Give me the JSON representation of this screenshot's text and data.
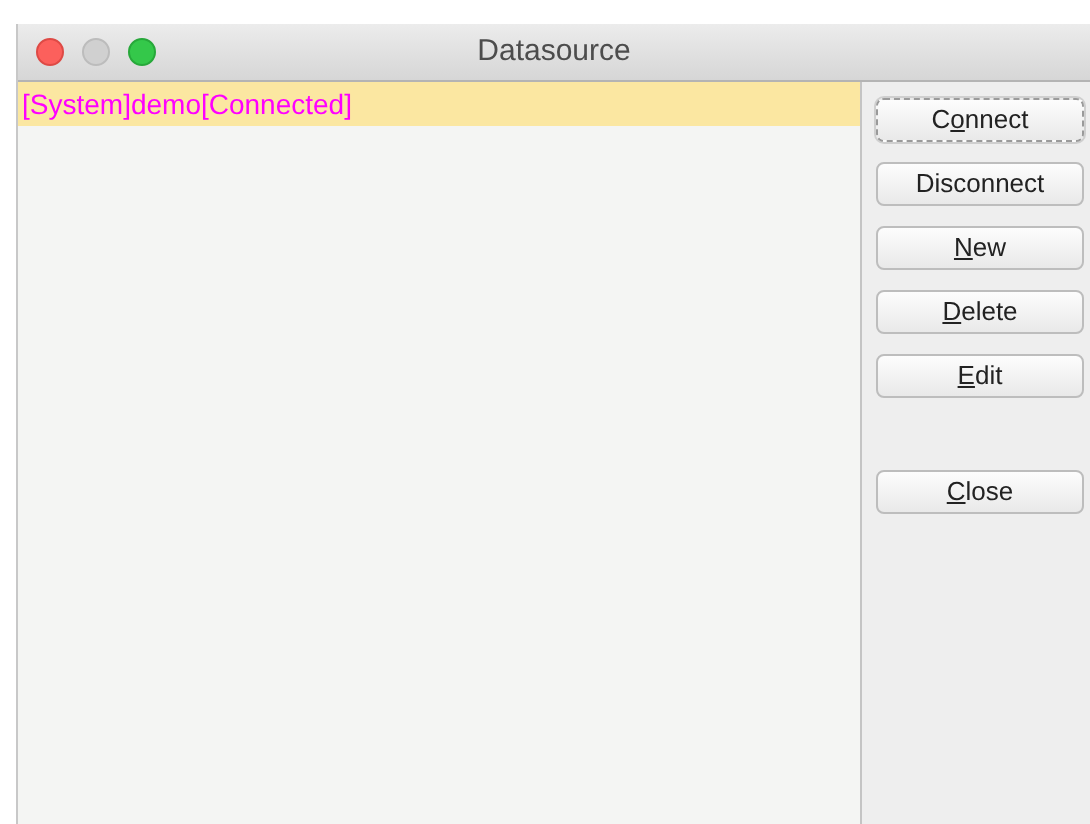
{
  "window": {
    "title": "Datasource"
  },
  "list": {
    "items": [
      {
        "label": "[System]demo[Connected]",
        "selected": true
      }
    ]
  },
  "buttons": [
    {
      "before": "C",
      "key": "o",
      "after": "nnect",
      "focused": true
    },
    {
      "before": "Disconnect",
      "focused": false
    },
    {
      "key": "N",
      "after": "ew",
      "focused": false
    },
    {
      "key": "D",
      "after": "elete",
      "focused": false
    },
    {
      "key": "E",
      "after": "dit",
      "focused": false
    }
  ],
  "bottom_buttons": [
    {
      "key": "C",
      "after": "lose",
      "focused": false
    }
  ]
}
